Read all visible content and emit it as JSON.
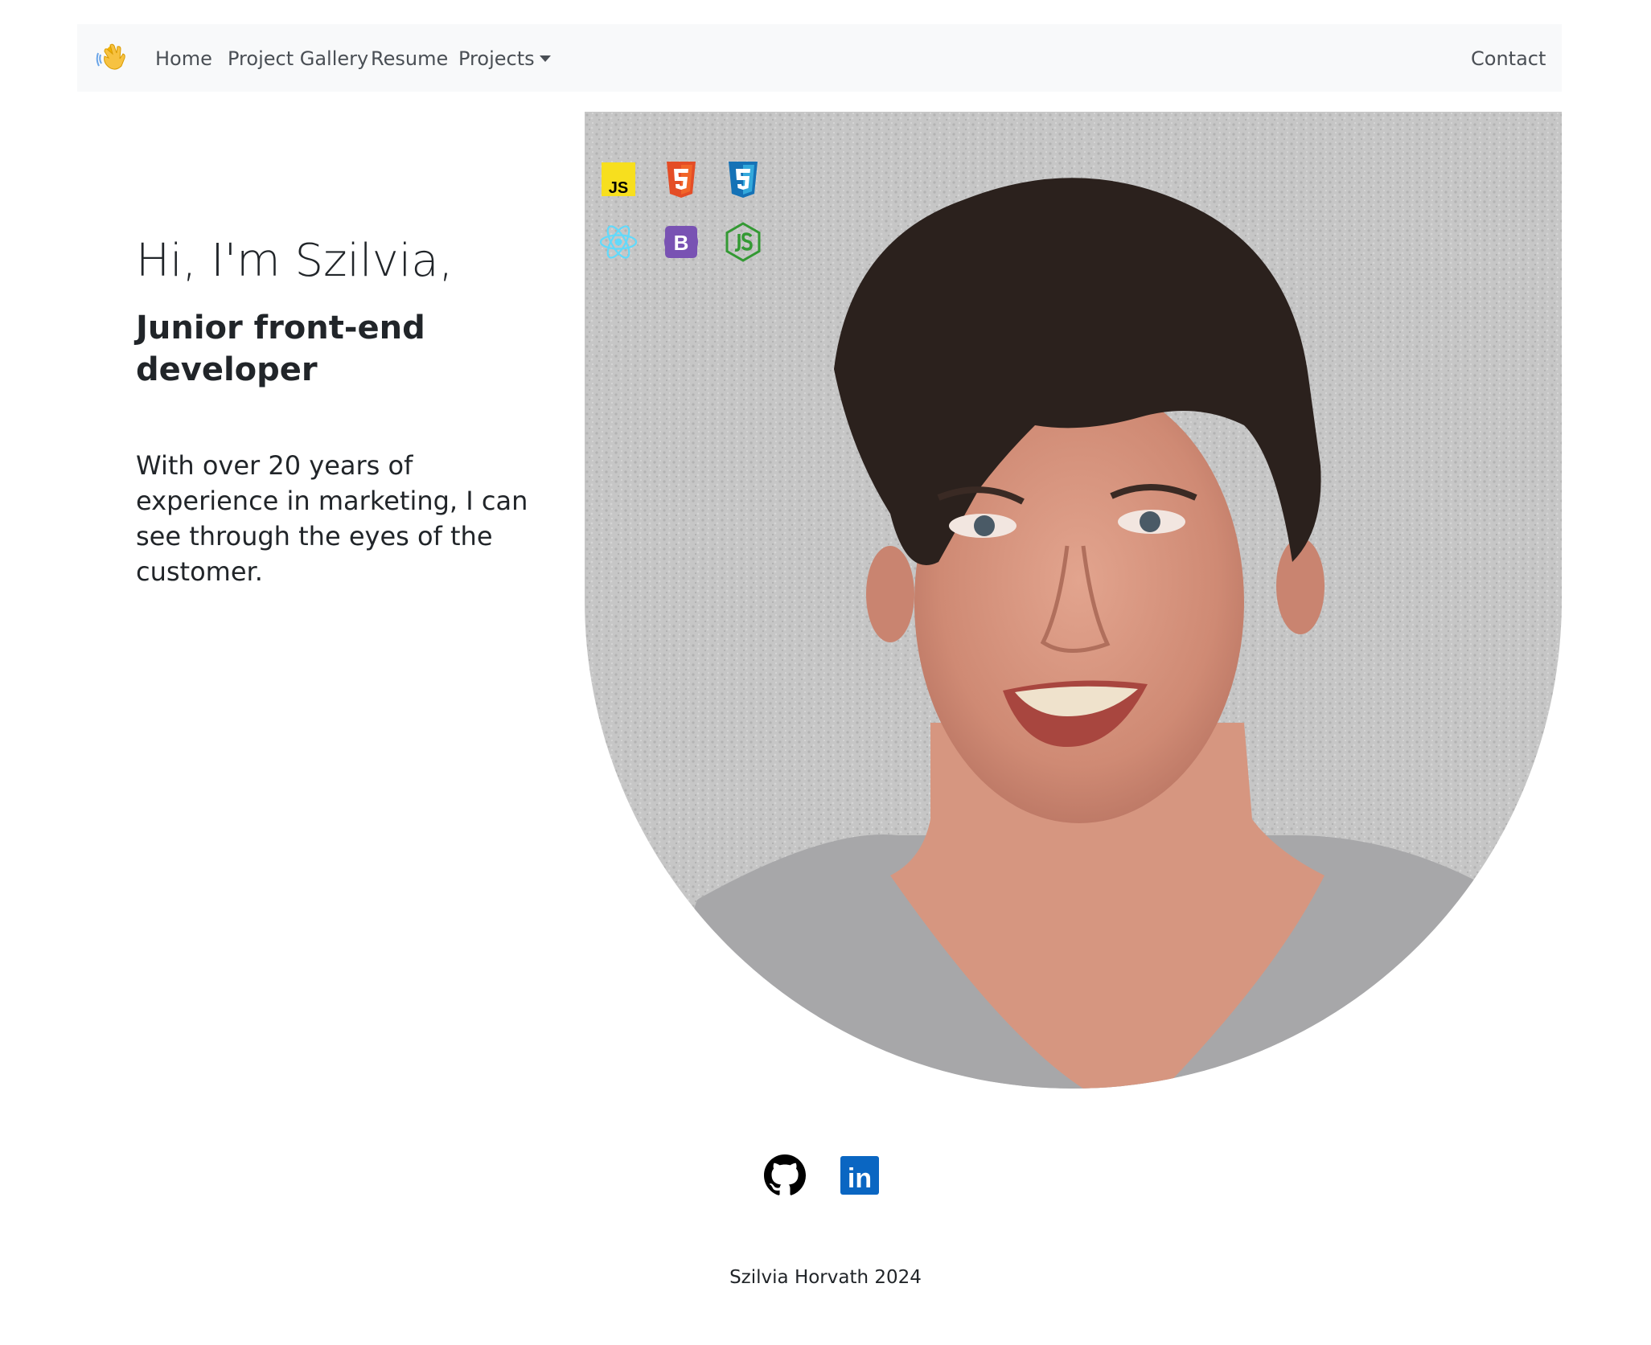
{
  "navbar": {
    "brand_icon": "waving-hand-icon",
    "links": [
      {
        "label": "Home"
      },
      {
        "label": "Project Gallery"
      },
      {
        "label": "Resume"
      },
      {
        "label": "Projects"
      }
    ],
    "contact_label": "Contact",
    "background": "#f8f9fa"
  },
  "hero": {
    "greeting": "Hi, I'm Szilvia,",
    "role": "Junior front-end developer",
    "description": "With over 20 years of experience in marketing, I can see through the eyes of the customer.",
    "tech_icons": [
      "javascript-icon",
      "html5-icon",
      "css3-icon",
      "react-icon",
      "bootstrap-icon",
      "nodejs-icon"
    ],
    "js_badge_text": "JS",
    "bootstrap_badge_text": "B"
  },
  "social": {
    "icons": [
      "github-icon",
      "linkedin-icon"
    ],
    "linkedin_text": "in",
    "linkedin_color": "#0a66c2"
  },
  "footer": {
    "text": "Szilvia Horvath 2024"
  }
}
